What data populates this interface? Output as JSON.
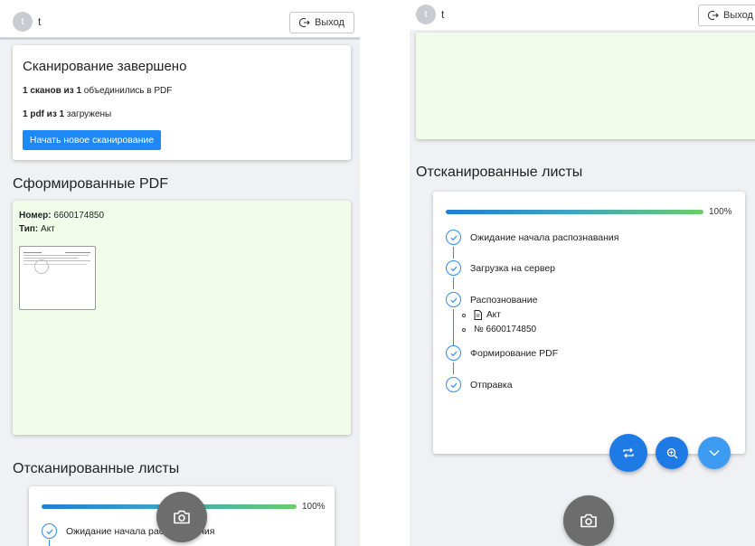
{
  "header": {
    "avatar_letter": "t",
    "username": "t",
    "logout_label": "Выход"
  },
  "scan_complete": {
    "title": "Сканирование завершено",
    "scans_bold": "1 сканов из 1",
    "scans_rest": " объединились в PDF",
    "pdf_bold": "1 pdf из 1",
    "pdf_rest": " загружены",
    "new_scan_button": "Начать новое сканирование"
  },
  "generated_pdf": {
    "title": "Сформированные PDF",
    "number_label": "Номер:",
    "number_value": " 6600174850",
    "type_label": "Тип:",
    "type_value": " Акт"
  },
  "scanned_sheets": {
    "title": "Отсканированные листы",
    "progress_percent": 100,
    "progress_label": "100%",
    "steps": [
      "Ожидание начала распознавания",
      "Загрузка на сервер",
      "Распознование",
      "Формирование PDF",
      "Отправка"
    ],
    "recognition_details": {
      "doc_type": "Акт",
      "doc_number": "№ 6600174850"
    }
  },
  "colors": {
    "primary": "#1e88f7",
    "pdf_card_bg": "#f1fde9",
    "fab_gray": "#6d6d6d",
    "fab_blue": "#1e7be6"
  },
  "icons": [
    "logout-icon",
    "camera-icon",
    "repeat-icon",
    "zoom-in-icon",
    "chevron-down-icon",
    "check-icon",
    "document-icon"
  ]
}
